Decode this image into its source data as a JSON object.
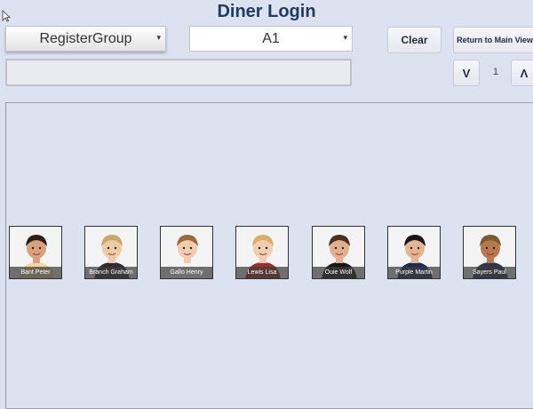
{
  "title": "Diner Login",
  "group_dropdown": {
    "value": "RegisterGroup"
  },
  "table_dropdown": {
    "value": "A1"
  },
  "buttons": {
    "clear": "Clear",
    "return": "Return to Main View",
    "down": "V",
    "up": "Λ"
  },
  "page_number": "1",
  "search": {
    "value": ""
  },
  "diners": [
    {
      "name": "Bant Peter",
      "hair": "#2a2018",
      "skin": "#d9a07c",
      "shirt": "#f1d8a0"
    },
    {
      "name": "Branch Graham",
      "hair": "#c9a86a",
      "skin": "#f0c9a6",
      "shirt": "#2d2d2d"
    },
    {
      "name": "Gallo Henry",
      "hair": "#9a6a3a",
      "skin": "#f2cdb0",
      "shirt": "#f7f7f7"
    },
    {
      "name": "Lewis Lisa",
      "hair": "#d8b06a",
      "skin": "#f2cdb0",
      "shirt": "#a02c2c"
    },
    {
      "name": "Ouie Wolf",
      "hair": "#4a3020",
      "skin": "#e2b08e",
      "shirt": "#161616"
    },
    {
      "name": "Purple Martin",
      "hair": "#161616",
      "skin": "#e5b591",
      "shirt": "#1d2b55"
    },
    {
      "name": "Sayers Paul",
      "hair": "#7a5a30",
      "skin": "#b57850",
      "shirt": "#2a3a4a"
    }
  ]
}
